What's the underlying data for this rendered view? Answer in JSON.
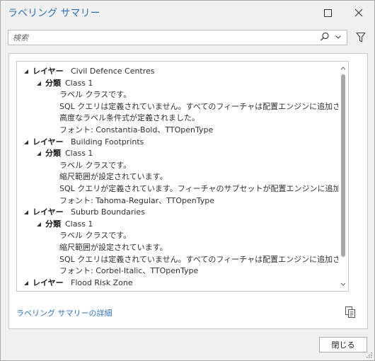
{
  "window": {
    "title": "ラベリング サマリー",
    "minimize_icon": "restore-square-icon",
    "close_icon": "close-x-icon"
  },
  "search": {
    "placeholder": "検索",
    "search_icon": "magnifier-icon",
    "dropdown_icon": "chevron-down-icon"
  },
  "filter": {
    "icon": "funnel-icon"
  },
  "tree": {
    "layer_keyword": "レイヤー",
    "class_keyword": "分類",
    "layers": [
      {
        "name": "Civil Defence Centres",
        "classes": [
          {
            "name": "Class 1",
            "details": [
              "ラベル クラスです。",
              "SQL クエリは定義されていません。すべてのフィーチャは配置エンジンに追加されます。",
              "高度なラベル条件式が定義されました。",
              "フォント: Constantia-Bold、TTOpenType"
            ]
          }
        ]
      },
      {
        "name": "Building Footprints",
        "classes": [
          {
            "name": "Class 1",
            "details": [
              "ラベル クラスです。",
              "縮尺範囲が設定されています。",
              "SQL クエリが定義されています。フィーチャのサブセットが配置エンジンに追加されます。",
              "フォント: Tahoma-Regular、TTOpenType"
            ]
          }
        ]
      },
      {
        "name": "Suburb Boundaries",
        "classes": [
          {
            "name": "Class 1",
            "details": [
              "ラベル クラスです。",
              "縮尺範囲が設定されています。",
              "SQL クエリは定義されていません。すべてのフィーチャは配置エンジンに追加されます。",
              "フォント: Corbel-Italic、TTOpenType"
            ]
          }
        ]
      },
      {
        "name": "Flood Risk Zone",
        "classes": []
      }
    ]
  },
  "details_link": "ラベリング サマリーの詳細",
  "copy_icon": "copy-icon",
  "close_button": "閉じる",
  "colors": {
    "accent": "#2f73b8"
  }
}
